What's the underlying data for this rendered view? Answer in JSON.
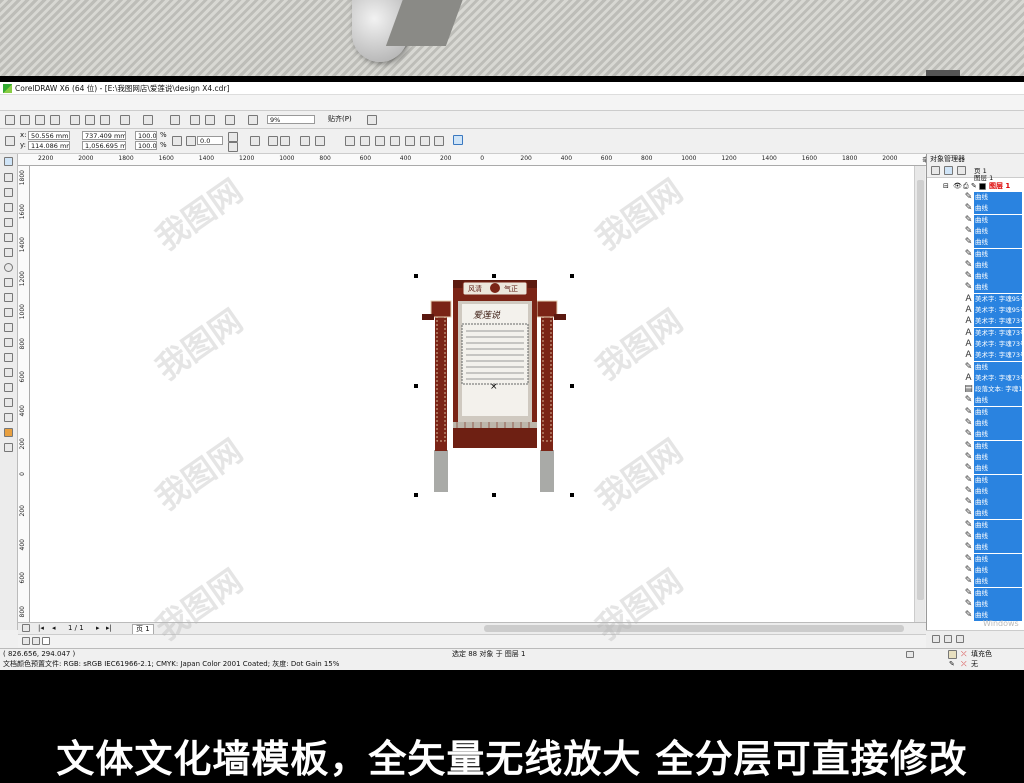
{
  "app": {
    "title": "CorelDRAW X6 (64 位) - [E:\\我图网店\\爱莲说\\design X4.cdr]",
    "zoom": "9%",
    "snap_label": "贴齐(P)"
  },
  "property_bar": {
    "x_label": "x:",
    "y_label": "y:",
    "x_value": "50.556 mm",
    "y_value": "114.086 mm",
    "width_value": "737.409 mm",
    "height_value": "1,056.695 mm",
    "scale_x": "100.0",
    "scale_y": "100.0",
    "percent": "%",
    "rotation": "0.0"
  },
  "ruler": {
    "h_ticks": [
      "2200",
      "2000",
      "1800",
      "1600",
      "1400",
      "1200",
      "1000",
      "800",
      "600",
      "400",
      "200",
      "0",
      "200",
      "400",
      "600",
      "800",
      "1000",
      "1200",
      "1400",
      "1600",
      "1800",
      "2000",
      "毫米"
    ],
    "v_ticks": [
      "1800",
      "1600",
      "1400",
      "1200",
      "1000",
      "800",
      "600",
      "400",
      "200",
      "0",
      "200",
      "400",
      "600",
      "800"
    ]
  },
  "artwork": {
    "left_text": "风清",
    "right_text": "气正",
    "poem_title": "爱莲说"
  },
  "page_nav": {
    "counter": "1 / 1",
    "page_tab": "页 1"
  },
  "status": {
    "coords": "( 826.656, 294.047 )",
    "selection": "选定 88 对象 于 图层 1",
    "color_profile": "文档颜色预置文件: RGB: sRGB IEC61966-2.1; CMYK: Japan Color 2001 Coated; 灰度: Dot Gain 15%",
    "fill_label": "填充色",
    "outline_label": "无"
  },
  "object_manager": {
    "title": "对象管理器",
    "page": "页 1",
    "layer_root": "图层 1",
    "layer": "图层 1",
    "items": [
      "曲线",
      "曲线",
      "曲线",
      "曲线",
      "曲线",
      "曲线",
      "曲线",
      "曲线",
      "曲线",
      "美术字: 字魂95号",
      "美术字: 字魂95号",
      "美术字: 字魂73号",
      "美术字: 字魂73号",
      "美术字: 字魂73号",
      "美术字: 字魂73号",
      "曲线",
      "美术字: 字魂73号",
      "段落文本: 字魂10号",
      "曲线",
      "曲线",
      "曲线",
      "曲线",
      "曲线",
      "曲线",
      "曲线",
      "曲线",
      "曲线",
      "曲线",
      "曲线",
      "曲线",
      "曲线",
      "曲线",
      "曲线",
      "曲线",
      "曲线",
      "曲线",
      "曲线",
      "曲线"
    ],
    "activation": "Windows"
  },
  "caption": "文体文化墙模板，全矢量无线放大 全分层可直接修改",
  "colors": {
    "wood": "#7a2416",
    "stone": "#a9aaa7",
    "highlight": "#2a83e0"
  }
}
